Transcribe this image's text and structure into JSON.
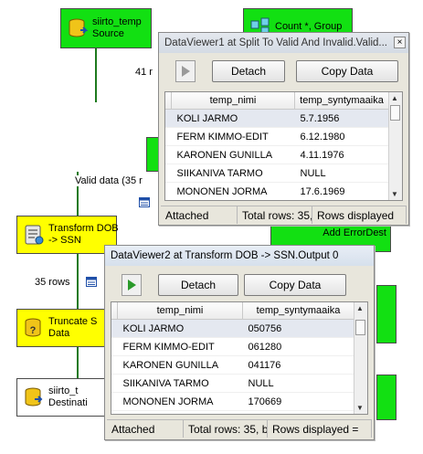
{
  "nodes": {
    "source": "siirto_temp\nSource",
    "count": "Count *, Group",
    "transform": "Transform DOB\n-> SSN",
    "truncate": "Truncate S\nData",
    "destination": "siirto_t\nDestinati",
    "add_error": "Add ErrorDest"
  },
  "paths": {
    "rows_41": "41 r",
    "valid_data": "Valid data (35 r",
    "rows_35": "35 rows"
  },
  "viewer1": {
    "title": "DataViewer1 at Split To Valid And Invalid.Valid...",
    "close_label": "×",
    "detach": "Detach",
    "copy_data": "Copy Data",
    "columns": [
      "temp_nimi",
      "temp_syntymaaika"
    ],
    "rows": [
      [
        "KOLI JARMO",
        "5.7.1956"
      ],
      [
        "FERM KIMMO-EDIT",
        "6.12.1980"
      ],
      [
        "KARONEN GUNILLA",
        "4.11.1976"
      ],
      [
        "SIIKANIVA TARMO",
        "NULL"
      ],
      [
        "MONONEN JORMA",
        "17.6.1969"
      ]
    ],
    "status": {
      "state": "Attached",
      "total": "Total rows: 35,",
      "displayed": "Rows displayed"
    }
  },
  "viewer2": {
    "title": "DataViewer2 at Transform DOB -> SSN.Output 0",
    "close_label": "×",
    "detach": "Detach",
    "copy_data": "Copy Data",
    "columns": [
      "temp_nimi",
      "temp_syntymaaika"
    ],
    "rows": [
      [
        "KOLI JARMO",
        "050756"
      ],
      [
        "FERM KIMMO-EDIT",
        "061280"
      ],
      [
        "KARONEN GUNILLA",
        "041176"
      ],
      [
        "SIIKANIVA TARMO",
        "NULL"
      ],
      [
        "MONONEN JORMA",
        "170669"
      ]
    ],
    "status": {
      "state": "Attached",
      "total": "Total rows: 35, b",
      "displayed": "Rows displayed ="
    }
  },
  "colors": {
    "green_task": "#12e012",
    "yellow_task": "#ffff00",
    "path_green": "#1d7a1d",
    "selection": "#e4e8f0"
  }
}
